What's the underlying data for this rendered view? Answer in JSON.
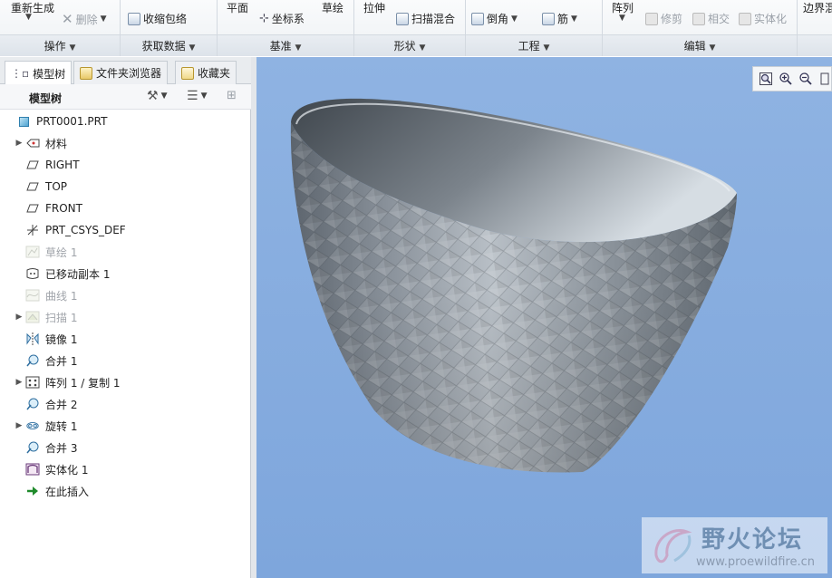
{
  "ribbon": {
    "groups": [
      {
        "label": "操作"
      },
      {
        "label": "获取数据"
      },
      {
        "label": "基准"
      },
      {
        "label": "形状"
      },
      {
        "label": "工程"
      },
      {
        "label": "编辑"
      }
    ],
    "buttons": {
      "regenerate": "重新生成",
      "delete": "删除",
      "shrinkwrap": "收缩包络",
      "plane": "平面",
      "sketch": "草绘",
      "csys": "坐标系",
      "extrude": "拉伸",
      "sweep_blend": "扫描混合",
      "chamfer": "倒角",
      "rib": "筋",
      "pattern": "阵列",
      "trim": "修剪",
      "intersect": "相交",
      "solidify": "实体化",
      "boundary": "边界混"
    }
  },
  "navigator": {
    "tabs": [
      "模型树",
      "文件夹浏览器",
      "收藏夹"
    ],
    "tree_title": "模型树",
    "root": "PRT0001.PRT",
    "items": [
      {
        "label": "材料",
        "expandable": true,
        "icon": "material-icon",
        "dim": false
      },
      {
        "label": "RIGHT",
        "expandable": false,
        "icon": "datum-plane-icon",
        "dim": false
      },
      {
        "label": "TOP",
        "expandable": false,
        "icon": "datum-plane-icon",
        "dim": false
      },
      {
        "label": "FRONT",
        "expandable": false,
        "icon": "datum-plane-icon",
        "dim": false
      },
      {
        "label": "PRT_CSYS_DEF",
        "expandable": false,
        "icon": "csys-icon",
        "dim": false
      },
      {
        "label": "草绘 1",
        "expandable": false,
        "icon": "sketch-icon",
        "dim": true
      },
      {
        "label": "已移动副本 1",
        "expandable": false,
        "icon": "moved-copy-icon",
        "dim": false
      },
      {
        "label": "曲线 1",
        "expandable": false,
        "icon": "curve-icon",
        "dim": true
      },
      {
        "label": "扫描 1",
        "expandable": true,
        "icon": "sweep-icon",
        "dim": true
      },
      {
        "label": "镜像 1",
        "expandable": false,
        "icon": "mirror-icon",
        "dim": false
      },
      {
        "label": "合并 1",
        "expandable": false,
        "icon": "merge-icon",
        "dim": false
      },
      {
        "label": "阵列 1 / 复制 1",
        "expandable": true,
        "icon": "pattern-icon",
        "dim": false
      },
      {
        "label": "合并 2",
        "expandable": false,
        "icon": "merge-icon",
        "dim": false
      },
      {
        "label": "旋转 1",
        "expandable": true,
        "icon": "revolve-icon",
        "dim": false
      },
      {
        "label": "合并 3",
        "expandable": false,
        "icon": "merge-icon",
        "dim": false
      },
      {
        "label": "实体化 1",
        "expandable": false,
        "icon": "solidify-icon",
        "dim": false
      },
      {
        "label": "在此插入",
        "expandable": false,
        "icon": "insert-here-icon",
        "dim": false
      }
    ]
  },
  "watermark": {
    "title": "野火论坛",
    "url": "www.proewildfire.cn"
  }
}
